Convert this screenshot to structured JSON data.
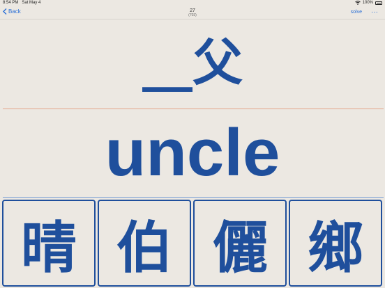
{
  "status": {
    "time": "8:54 PM",
    "date": "Sat May 4",
    "battery": "100%"
  },
  "nav": {
    "back_label": "Back",
    "count": "27",
    "total": "(703)",
    "solve_label": "solve",
    "more_label": "···"
  },
  "prompt": "__父",
  "meaning": "uncle",
  "choices": [
    "晴",
    "伯",
    "儷",
    "鄉"
  ],
  "colors": {
    "accent": "#2a6fd6",
    "ink": "#1f4f9c",
    "background": "#ece8e2"
  }
}
